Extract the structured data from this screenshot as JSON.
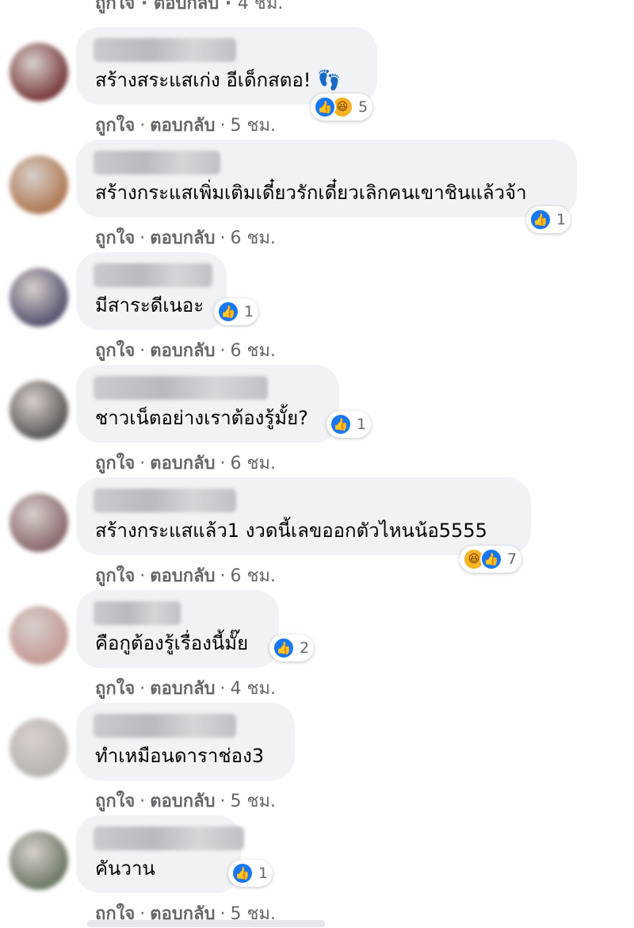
{
  "top_partial": {
    "like": "ถูกใจ",
    "reply": "ตอบกลับ",
    "time": "4 ชม."
  },
  "labels": {
    "like": "ถูกใจ",
    "reply": "ตอบกลับ",
    "sep": "·"
  },
  "comments": [
    {
      "text": "สร้างสระแสเก่ง อีเด็กสตอ! 👣",
      "reactions": [
        "like",
        "haha"
      ],
      "count": "5",
      "time": "5 ชม."
    },
    {
      "text": "สร้างกระแสเพิ่มเติมเดี๋ยวรักเดี๋ยวเลิกคนเขาชินแล้วจ้า",
      "reactions": [
        "like"
      ],
      "count": "1",
      "time": "6 ชม."
    },
    {
      "text": "มีสาระดีเนอะ",
      "reactions": [
        "like"
      ],
      "count": "1",
      "time": "6 ชม."
    },
    {
      "text": "ชาวเน็ตอย่างเราต้องรู้มั้ย?",
      "reactions": [
        "like"
      ],
      "count": "1",
      "time": "6 ชม."
    },
    {
      "text": "สร้างกระแสแล้ว1 งวดนี้เลขออกตัวไหนน้อ5555",
      "reactions": [
        "haha",
        "like"
      ],
      "count": "7",
      "time": "6 ชม."
    },
    {
      "text": "คือกูต้องรู้เรื่องนี้มั๊ย",
      "reactions": [
        "like"
      ],
      "count": "2",
      "time": "4 ชม."
    },
    {
      "text": "ทำเหมือนดาราช่อง3",
      "reactions": [],
      "count": "",
      "time": "5 ชม."
    },
    {
      "text": "คันวาน",
      "reactions": [
        "like"
      ],
      "count": "1",
      "time": "5 ชม."
    }
  ],
  "colors": {
    "like": "#1877f2",
    "haha": "#f7b125",
    "bubble": "#f0f2f5",
    "meta": "#65676b"
  },
  "icons": {
    "like": "thumbs-up-icon",
    "haha": "laughing-face-icon"
  }
}
